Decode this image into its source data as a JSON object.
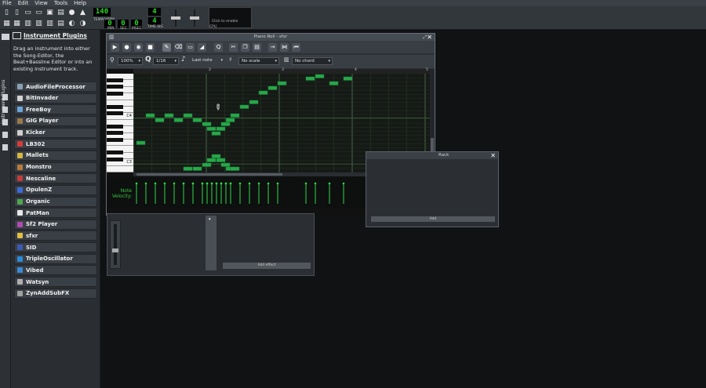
{
  "menubar": {
    "items": [
      "File",
      "Edit",
      "View",
      "Tools",
      "Help"
    ]
  },
  "toolbar": {
    "tempo": "140",
    "tempo_label": "TEMPO/BPM",
    "time_min": "0",
    "time_sec": "0",
    "time_msec": "0",
    "min_label": "MIN",
    "sec_label": "SEC",
    "msec_label": "MSEC",
    "timesig_num": "4",
    "timesig_den": "4",
    "timesig_label": "TIME SIG",
    "cpu_hint": "Click to enable",
    "cpu_label": "CPU"
  },
  "sidetab": {
    "label": "Instrument Plugins"
  },
  "browser": {
    "title": "Instrument Plugins",
    "description": "Drag an instrument into either the Song-Editor, the Beat+Bassline Editor or into an existing instrument track.",
    "plugins": [
      "AudioFileProcessor",
      "BitInvader",
      "FreeBoy",
      "GIG Player",
      "Kicker",
      "LB302",
      "Mallets",
      "Monstro",
      "Nescaline",
      "OpulenZ",
      "Organic",
      "PatMan",
      "Sf2 Player",
      "sfxr",
      "SID",
      "TripleOscillator",
      "Vibed",
      "Watsyn",
      "ZynAddSubFX"
    ],
    "plugin_colors": [
      "#8aa0b4",
      "#d2d2d2",
      "#6aa5d8",
      "#9a7a4a",
      "#cfcfcf",
      "#d83a3a",
      "#d8b640",
      "#b87a3a",
      "#c83a3a",
      "#3a6ad8",
      "#4fa64f",
      "#e8e8e8",
      "#b04ab0",
      "#e0c040",
      "#3a5ab8",
      "#2a8ad8",
      "#3a8ad8",
      "#b0b0b0",
      "#a0a0a0"
    ]
  },
  "pianoroll": {
    "title": "Piano Roll - sfxr",
    "zoom": "100%",
    "quantize": "1/16",
    "note_length": "Last note",
    "scale": "No scale",
    "chord": "No chord",
    "key_c4": "C4",
    "key_c3": "C3",
    "bar_numbers": [
      "2",
      "3",
      "4",
      "5"
    ],
    "velocity_label": "Note\nVelocity:"
  },
  "fx": {
    "add_effect": "Add effect"
  },
  "rack": {
    "title": "Rack",
    "add": "Add"
  },
  "colors": {
    "note": "#27a84a",
    "note_dark": "#1b7a35",
    "velocity": "#2fd84a"
  }
}
